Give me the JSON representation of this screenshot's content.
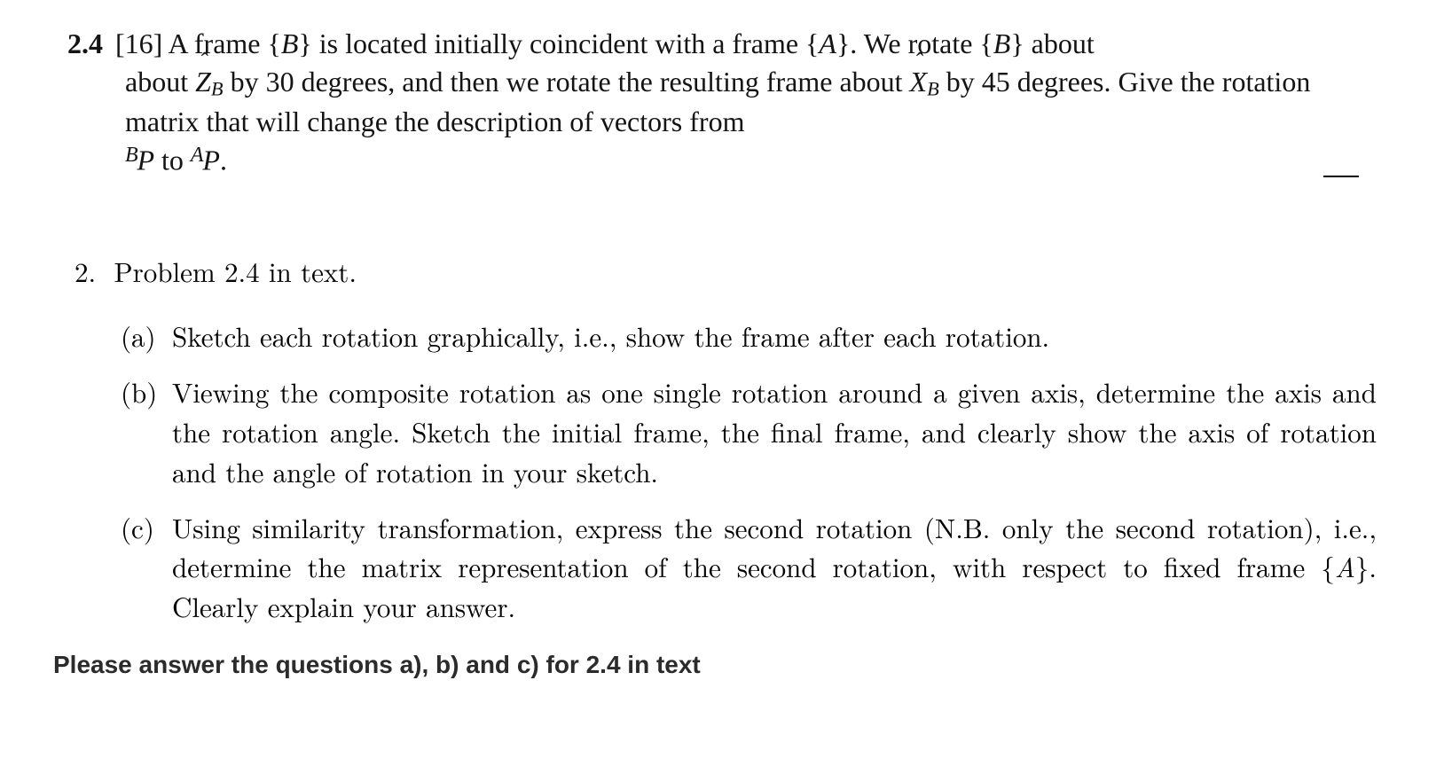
{
  "problem": {
    "number": "2.4",
    "marks": "[16]",
    "seg1": " A frame {",
    "frameB1": "B",
    "seg2": "} is located initially coincident with a frame {",
    "frameA": "A",
    "seg3": "}. We rotate {",
    "frameB2": "B",
    "seg4": "} about ",
    "zhat_letter": "Z",
    "zhat_sub": "B",
    "seg5": " by 30 degrees, and then we rotate the resulting frame about ",
    "xhat_letter": "X",
    "xhat_sub": "B",
    "seg6": " by 45 degrees. Give the rotation matrix that will change the description of vectors from ",
    "bp_super": "B",
    "bp_letter": "P",
    "seg7": " to ",
    "ap_super": "A",
    "ap_letter": "P",
    "seg8": "."
  },
  "section": {
    "outer_label": "2.",
    "outer_text": "Problem 2.4 in text.",
    "items": [
      {
        "label": "(a)",
        "text": "Sketch each rotation graphically, i.e., show the frame after each rotation."
      },
      {
        "label": "(b)",
        "text": "Viewing the composite rotation as one single rotation around a given axis, determine the axis and the rotation angle. Sketch the initial frame, the final frame, and clearly show the axis of rotation and the angle of rotation in your sketch."
      },
      {
        "label": "(c)",
        "text_pre": "Using similarity transformation, express the second rotation (N.B. only the second rotation), i.e., determine the matrix representation of the second rotation, with respect to fixed frame {",
        "frame_letter": "A",
        "text_post": "}. Clearly explain your answer."
      }
    ]
  },
  "instruction": "Please answer the questions a), b) and c) for 2.4 in text"
}
